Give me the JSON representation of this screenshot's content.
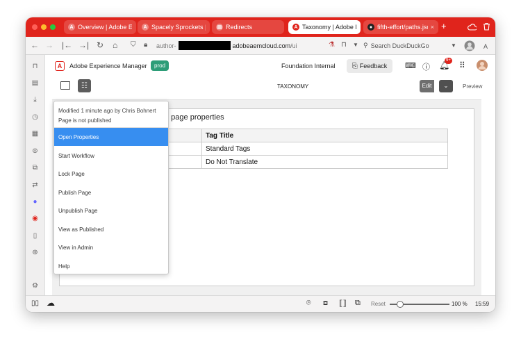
{
  "browser": {
    "tabs": [
      {
        "label": "Overview | Adobe Expe",
        "icon": "adobe-icon"
      },
      {
        "label": "Spacely Sprockets | AE",
        "icon": "adobe-icon"
      },
      {
        "label": "Redirects",
        "icon": "document-icon"
      },
      {
        "label": "Taxonomy | Adobe Exp",
        "icon": "adobe-icon"
      },
      {
        "label": "fifth-effort/paths.json",
        "icon": "github-icon"
      }
    ],
    "new_tab": "+",
    "url_prefix": "author-",
    "url_domain": "adobeaemcloud.com",
    "url_path": "/ui",
    "search_placeholder": "Search DuckDuckGo",
    "colors": {
      "tabbar": "#e0241c"
    }
  },
  "aem": {
    "logo_letter": "A",
    "app_title": "Adobe Experience Manager",
    "env_badge": "prod",
    "org": "Foundation Internal",
    "feedback": "Feedback",
    "notification_count": "9+",
    "page_title": "TAXONOMY",
    "edit": "Edit",
    "preview": "Preview"
  },
  "menu": {
    "modified": "Modified 1 minute ago by Chris Bohnert",
    "published": "Page is not published",
    "items": [
      "Open Properties",
      "Start Workflow",
      "Lock Page",
      "Publish Page",
      "Unpublish Page",
      "View as Published",
      "View in Admin",
      "Help"
    ]
  },
  "document": {
    "heading": "n page properties",
    "table_header": "Tag Title",
    "rows": [
      "Standard Tags",
      "Do Not Translate"
    ]
  },
  "status": {
    "reset": "Reset",
    "zoom_percent": 100,
    "zoom": "100 %",
    "time": "15:59"
  }
}
